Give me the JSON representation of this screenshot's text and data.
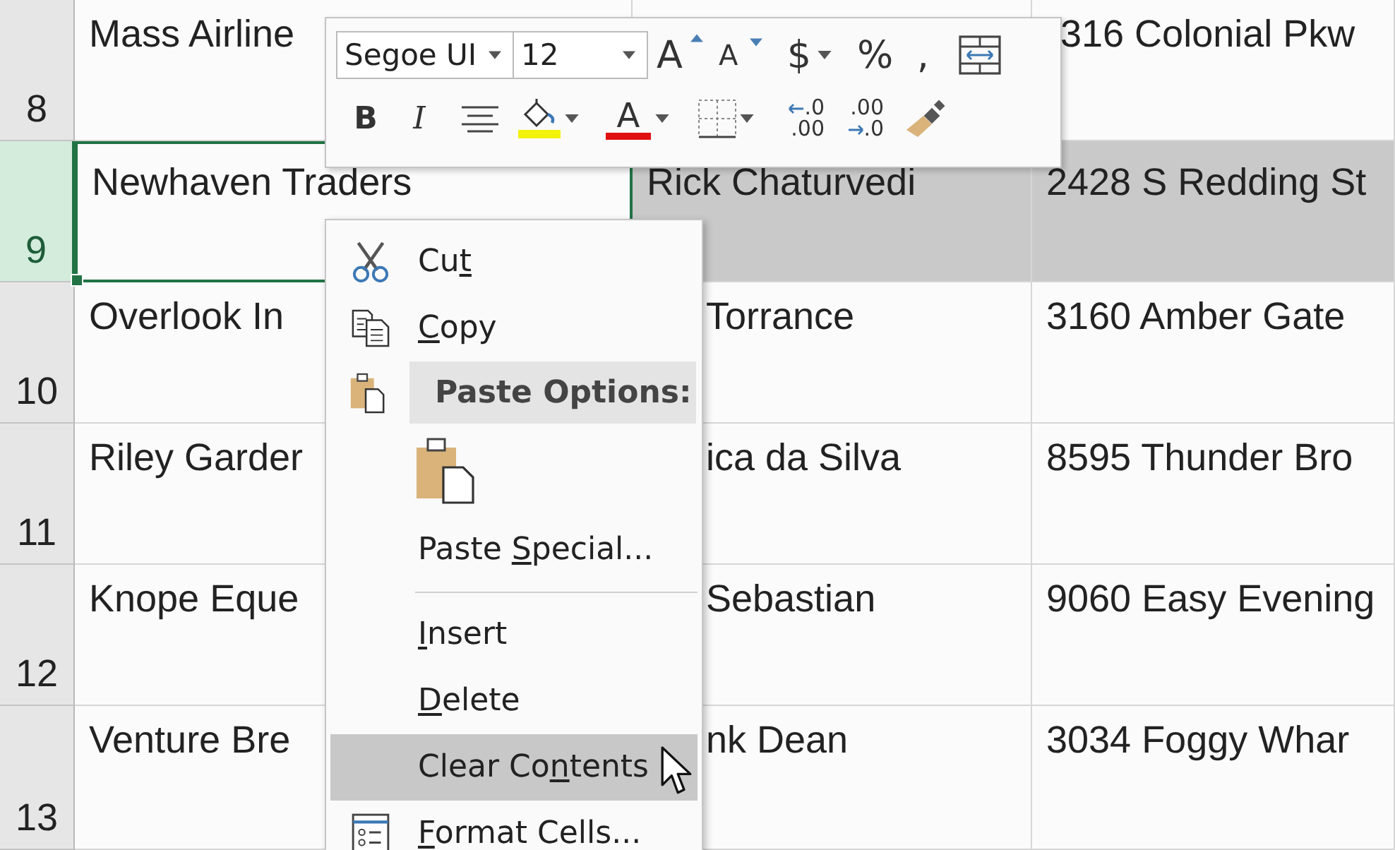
{
  "sheet": {
    "rows": [
      {
        "number": "8",
        "selected": false,
        "column_1": "Mass Airline",
        "column_3": "316 Colonial Pkw"
      },
      {
        "number": "9",
        "selected": true,
        "column_1": "Newhaven Traders",
        "column_2": "Rick Chaturvedi",
        "column_3": "2428 S Redding St"
      },
      {
        "number": "10",
        "selected": false,
        "column_1": "Overlook In",
        "column_2": "Torrance",
        "column_3": "3160 Amber Gate"
      },
      {
        "number": "11",
        "selected": false,
        "column_1": "Riley Garder",
        "column_2": "ica da Silva",
        "column_3": "8595 Thunder Bro"
      },
      {
        "number": "12",
        "selected": false,
        "column_1": "Knope Eque",
        "column_2": "Sebastian",
        "column_3": "9060 Easy Evening"
      },
      {
        "number": "13",
        "selected": false,
        "column_1": "Venture Bre",
        "column_2": "nk Dean",
        "column_3": "3034 Foggy Whar"
      }
    ]
  },
  "mini_toolbar": {
    "row_1": [
      {
        "kind": "font",
        "value": "Segoe UI"
      },
      {
        "kind": "size",
        "value": "12"
      },
      {
        "kind": "grow",
        "label": "A"
      },
      {
        "kind": "shrink",
        "label": "A"
      },
      {
        "kind": "glyph",
        "label": "$",
        "dropdown": true
      },
      {
        "kind": "glyph",
        "label": "%"
      },
      {
        "kind": "glyph",
        "label": ","
      },
      {
        "kind": "wrap"
      }
    ],
    "row_2": [
      {
        "kind": "bold",
        "label": "B"
      },
      {
        "kind": "italic",
        "label": "I"
      },
      {
        "kind": "center"
      },
      {
        "kind": "fill",
        "color": "#f2f20a",
        "dropdown": true
      },
      {
        "kind": "fontcolor",
        "label": "A",
        "color": "#e01010",
        "dropdown": true
      },
      {
        "kind": "borders",
        "dropdown": true
      },
      {
        "kind": "adddecimal",
        "upper": ".0",
        "lower": ".00"
      },
      {
        "kind": "removedecimal",
        "upper": ".00",
        "lower": ".0"
      },
      {
        "kind": "painter"
      }
    ]
  },
  "context_menu": {
    "items": [
      {
        "kind": "cut",
        "before": "Cu",
        "key": "t",
        "selected": false
      },
      {
        "kind": "copy",
        "key": "C",
        "after": "opy",
        "selected": false
      },
      {
        "kind": "header",
        "after": "Paste Options:",
        "selected": false
      },
      {
        "kind": "paste",
        "selected": false
      },
      {
        "kind": "plain",
        "before": "Paste ",
        "key": "S",
        "after": "pecial...",
        "selected": false
      },
      {
        "kind": "rule"
      },
      {
        "kind": "plain",
        "key": "I",
        "after": "nsert",
        "selected": false
      },
      {
        "kind": "plain",
        "key": "D",
        "after": "elete",
        "selected": false
      },
      {
        "kind": "plain",
        "before": "Clear Co",
        "key": "n",
        "after": "tents",
        "selected": true
      },
      {
        "kind": "format",
        "key": "F",
        "after": "ormat Cells...",
        "selected": false
      }
    ]
  }
}
